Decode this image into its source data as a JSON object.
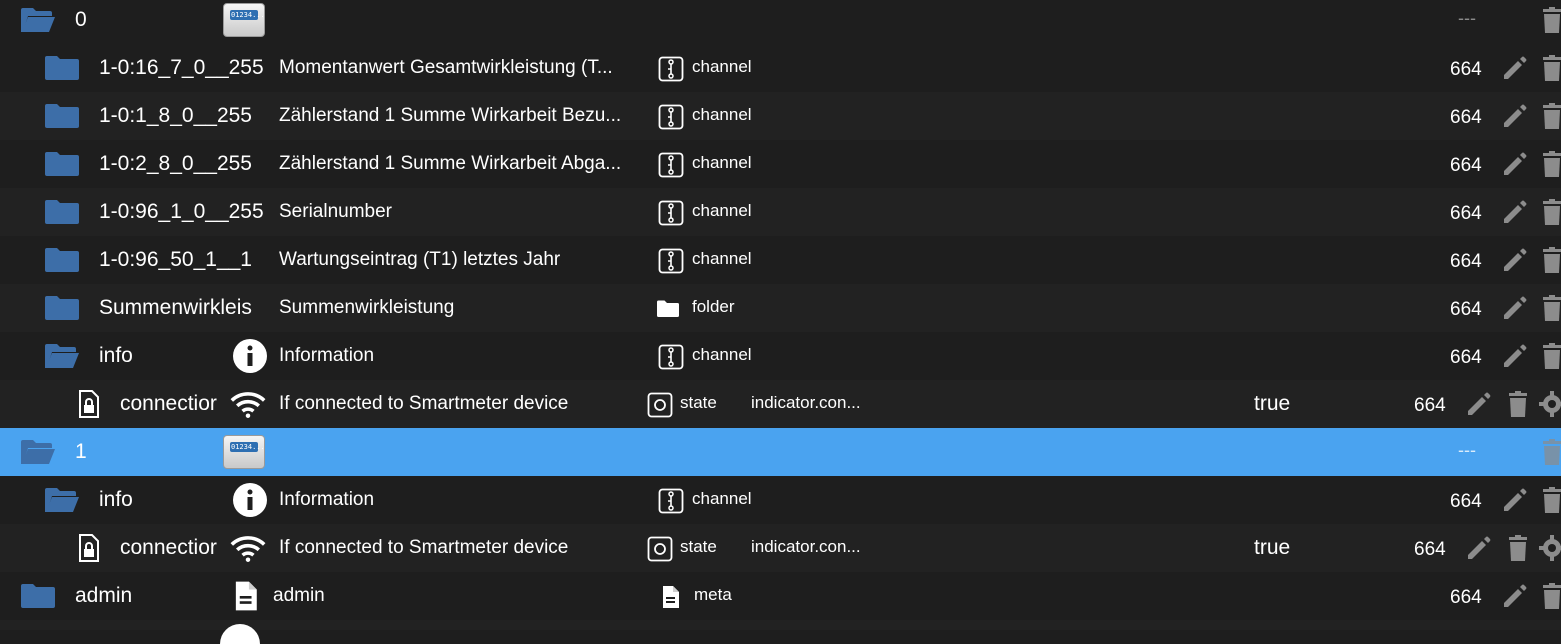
{
  "colors": {
    "background": "#1e1e1e",
    "selected_row": "#4aa3f0",
    "folder_blue": "#3d6ea8",
    "icon_grey": "#8c8c8c",
    "text": "#ffffff"
  },
  "rows": [
    {
      "id": "0",
      "name": "",
      "type": "",
      "role": "",
      "value": "",
      "acl": "---",
      "has_logo": true,
      "logo_text": "01234..."
    },
    {
      "id": "1-0:16_7_0__255",
      "name": "Momentanwert Gesamtwirkleistung (T...",
      "type": "channel",
      "acl": "664"
    },
    {
      "id": "1-0:1_8_0__255",
      "name": "Zählerstand 1 Summe Wirkarbeit Bezu...",
      "type": "channel",
      "acl": "664"
    },
    {
      "id": "1-0:2_8_0__255",
      "name": "Zählerstand 1 Summe Wirkarbeit Abga...",
      "type": "channel",
      "acl": "664"
    },
    {
      "id": "1-0:96_1_0__255",
      "name": "Serialnumber",
      "type": "channel",
      "acl": "664"
    },
    {
      "id": "1-0:96_50_1__1",
      "name": "Wartungseintrag (T1) letztes Jahr",
      "type": "channel",
      "acl": "664"
    },
    {
      "id": "Summenwirkleis",
      "name": "Summenwirkleistung",
      "type": "folder",
      "acl": "664"
    },
    {
      "id": "info",
      "name": "Information",
      "type": "channel",
      "acl": "664"
    },
    {
      "id": "connectior",
      "name": "If connected to Smartmeter device",
      "type": "state",
      "role": "indicator.con...",
      "value": "true",
      "acl": "664"
    },
    {
      "id": "1",
      "acl": "---",
      "logo_text": "01234..."
    },
    {
      "id": "info",
      "name": "Information",
      "type": "channel",
      "acl": "664"
    },
    {
      "id": "connectior",
      "name": "If connected to Smartmeter device",
      "type": "state",
      "role": "indicator.con...",
      "value": "true",
      "acl": "664"
    },
    {
      "id": "admin",
      "name": "admin",
      "type": "meta",
      "acl": "664"
    }
  ]
}
